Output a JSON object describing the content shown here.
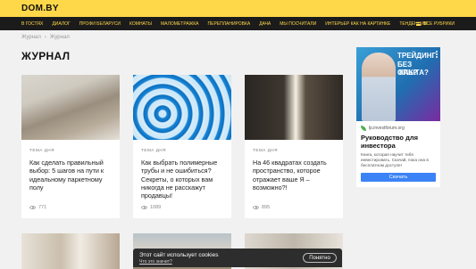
{
  "header": {
    "logo": "DOM.BY"
  },
  "nav": {
    "items": [
      "В ГОСТЯХ",
      "ДИАЛОГ",
      "ПРОФИ БЕЛАРУСИ",
      "КОМНАТЫ",
      "МАЛОМЕТРАЖКА",
      "ПЕРЕПЛАНИРОВКА",
      "ДАЧА",
      "МЫ ПОСЧИТАЛИ",
      "ИНТЕРЬЕР КАК НА КАРТИНКЕ",
      "ТЕНДЕНЦИИ"
    ],
    "all_label": "ВСЕ РУБРИКИ"
  },
  "breadcrumb": {
    "items": [
      "Журнал",
      "Журнал"
    ],
    "separator": "›"
  },
  "page": {
    "title": "ЖУРНАЛ"
  },
  "cards": [
    {
      "tag": "ТЕМА ДНЯ",
      "title": "Как сделать правильный выбор: 5 шагов на пути к идеальному паркетному полу",
      "views": "771"
    },
    {
      "tag": "ТЕМА ДНЯ",
      "title": "Как выбрать полимерные трубы и не ошибиться? Секреты, о которых вам никогда не расскажут продавцы!",
      "views": "1089"
    },
    {
      "tag": "ТЕМА ДНЯ",
      "title": "На 46 квадратах создать пространство, которое отражает ваше Я – возможно?!",
      "views": "895"
    }
  ],
  "ad": {
    "headline": [
      "ТРЕЙДИНГ",
      "БЕЗ ОПЫТА?",
      "КАК?"
    ],
    "source": "lp.investforum.org",
    "title": "Руководство для инвестора",
    "text": "Книга, которая научит тебя инвестировать. Скачай, пока она в бесплатном доступе!",
    "button": "Скачать"
  },
  "cookie": {
    "text": "Этот сайт использует cookies",
    "link": "Что это значит?",
    "button": "Понятно"
  }
}
